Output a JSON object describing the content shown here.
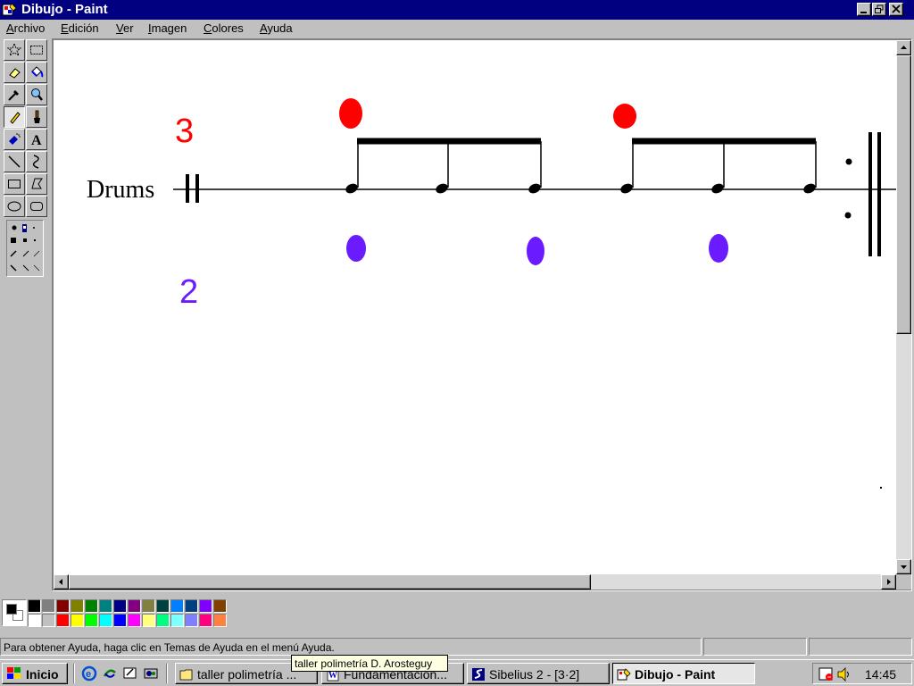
{
  "window": {
    "title": "Dibujo - Paint"
  },
  "menu": {
    "items": [
      {
        "label": "Archivo",
        "key": "A",
        "rest": "rchivo"
      },
      {
        "label": "Edición",
        "key": "E",
        "rest": "dición"
      },
      {
        "label": "Ver",
        "key": "V",
        "rest": "er"
      },
      {
        "label": "Imagen",
        "key": "I",
        "rest": "magen"
      },
      {
        "label": "Colores",
        "key": "C",
        "rest": "olores"
      },
      {
        "label": "Ayuda",
        "key": "A",
        "rest": "yuda"
      }
    ]
  },
  "tools": [
    {
      "name": "free-select",
      "icon": "star-select-icon"
    },
    {
      "name": "rect-select",
      "icon": "rect-select-icon"
    },
    {
      "name": "eraser",
      "icon": "eraser-icon"
    },
    {
      "name": "fill",
      "icon": "paint-bucket-icon"
    },
    {
      "name": "pick-color",
      "icon": "eyedropper-icon"
    },
    {
      "name": "magnifier",
      "icon": "magnifier-icon"
    },
    {
      "name": "pencil",
      "icon": "pencil-icon",
      "active": true
    },
    {
      "name": "brush",
      "icon": "brush-icon"
    },
    {
      "name": "airbrush",
      "icon": "airbrush-icon"
    },
    {
      "name": "text",
      "icon": "text-icon",
      "glyph": "A"
    },
    {
      "name": "line",
      "icon": "line-icon"
    },
    {
      "name": "curve",
      "icon": "curve-icon"
    },
    {
      "name": "rectangle",
      "icon": "rectangle-icon"
    },
    {
      "name": "polygon",
      "icon": "polygon-icon"
    },
    {
      "name": "ellipse",
      "icon": "ellipse-icon"
    },
    {
      "name": "rounded-rect",
      "icon": "rounded-rect-icon"
    }
  ],
  "drawing": {
    "instrument_label": "Drums",
    "upper_number": "3",
    "lower_number": "2",
    "colors": {
      "upper": "#ff0000",
      "lower": "#6a1bff",
      "ink": "#000000"
    }
  },
  "palette": {
    "top": [
      "#000000",
      "#808080",
      "#800000",
      "#808000",
      "#008000",
      "#008080",
      "#000080",
      "#800080",
      "#808040",
      "#004040",
      "#0080ff",
      "#004080",
      "#8000ff",
      "#804000"
    ],
    "bottom": [
      "#ffffff",
      "#c0c0c0",
      "#ff0000",
      "#ffff00",
      "#00ff00",
      "#00ffff",
      "#0000ff",
      "#ff00ff",
      "#ffff80",
      "#00ff80",
      "#80ffff",
      "#8080ff",
      "#ff0080",
      "#ff8040"
    ]
  },
  "status": {
    "help_text": "Para obtener Ayuda, haga clic en Temas de Ayuda en el menú Ayuda."
  },
  "taskbar": {
    "start_label": "Inicio",
    "tasks": [
      {
        "label": "taller polimetría ...",
        "icon": "folder-icon"
      },
      {
        "label": "Fundamentación...",
        "icon": "word-icon"
      },
      {
        "label": "Sibelius 2 - [3·2]",
        "icon": "sibelius-icon"
      },
      {
        "label": "Dibujo - Paint",
        "icon": "paint-icon",
        "active": true
      }
    ],
    "clock": "14:45",
    "tooltip": "taller polimetría D. Arosteguy"
  }
}
